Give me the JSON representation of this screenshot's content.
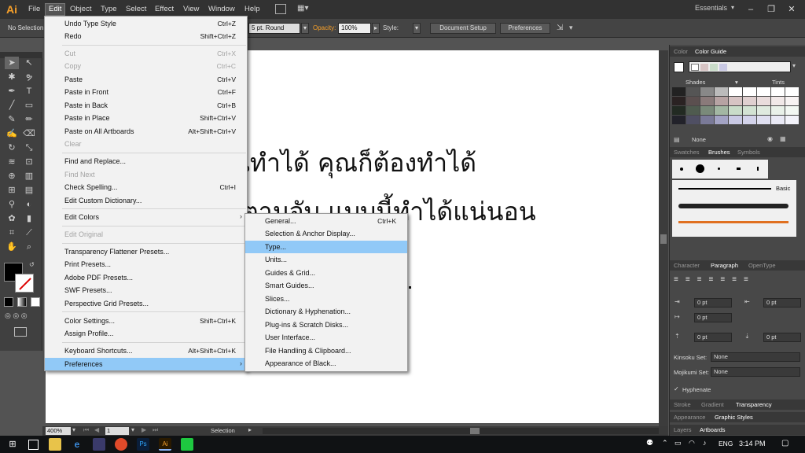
{
  "app": {
    "logo": "Ai",
    "menus": [
      "File",
      "Edit",
      "Object",
      "Type",
      "Select",
      "Effect",
      "View",
      "Window",
      "Help"
    ],
    "workspace": "Essentials",
    "window_controls": [
      "–",
      "❐",
      "✕"
    ]
  },
  "control_bar": {
    "selection_status": "No Selection",
    "brush": "5 pt. Round",
    "opacity_label": "Opacity:",
    "opacity_value": "100%",
    "style_label": "Style:",
    "document_setup": "Document Setup",
    "preferences": "Preferences"
  },
  "canvas": {
    "line1": "นทำได้ คุณก็ต้องทำได้",
    "line2": "ตามจับ แบบนี้ทำได้แน่นอน"
  },
  "status": {
    "zoom": "400%",
    "page": "1",
    "tool": "Selection"
  },
  "edit_menu": {
    "items": [
      {
        "label": "Undo Type Style",
        "shortcut": "Ctrl+Z"
      },
      {
        "label": "Redo",
        "shortcut": "Shift+Ctrl+Z"
      },
      {
        "label": "Cut",
        "shortcut": "Ctrl+X"
      },
      {
        "label": "Copy",
        "shortcut": "Ctrl+C"
      },
      {
        "label": "Paste",
        "shortcut": "Ctrl+V"
      },
      {
        "label": "Paste in Front",
        "shortcut": "Ctrl+F"
      },
      {
        "label": "Paste in Back",
        "shortcut": "Ctrl+B"
      },
      {
        "label": "Paste in Place",
        "shortcut": "Shift+Ctrl+V"
      },
      {
        "label": "Paste on All Artboards",
        "shortcut": "Alt+Shift+Ctrl+V"
      },
      {
        "label": "Clear",
        "shortcut": ""
      },
      {
        "label": "Find and Replace...",
        "shortcut": ""
      },
      {
        "label": "Find Next",
        "shortcut": ""
      },
      {
        "label": "Check Spelling...",
        "shortcut": "Ctrl+I"
      },
      {
        "label": "Edit Custom Dictionary...",
        "shortcut": ""
      },
      {
        "label": "Edit Colors",
        "shortcut": ""
      },
      {
        "label": "Edit Original",
        "shortcut": ""
      },
      {
        "label": "Transparency Flattener Presets...",
        "shortcut": ""
      },
      {
        "label": "Print Presets...",
        "shortcut": ""
      },
      {
        "label": "Adobe PDF Presets...",
        "shortcut": ""
      },
      {
        "label": "SWF Presets...",
        "shortcut": ""
      },
      {
        "label": "Perspective Grid Presets...",
        "shortcut": ""
      },
      {
        "label": "Color Settings...",
        "shortcut": "Shift+Ctrl+K"
      },
      {
        "label": "Assign Profile...",
        "shortcut": ""
      },
      {
        "label": "Keyboard Shortcuts...",
        "shortcut": "Alt+Shift+Ctrl+K"
      },
      {
        "label": "Preferences",
        "shortcut": ""
      }
    ]
  },
  "prefs_menu": {
    "items": [
      {
        "label": "General...",
        "shortcut": "Ctrl+K"
      },
      {
        "label": "Selection & Anchor Display...",
        "shortcut": ""
      },
      {
        "label": "Type...",
        "shortcut": ""
      },
      {
        "label": "Units...",
        "shortcut": ""
      },
      {
        "label": "Guides & Grid...",
        "shortcut": ""
      },
      {
        "label": "Smart Guides...",
        "shortcut": ""
      },
      {
        "label": "Slices...",
        "shortcut": ""
      },
      {
        "label": "Dictionary & Hyphenation...",
        "shortcut": ""
      },
      {
        "label": "Plug-ins & Scratch Disks...",
        "shortcut": ""
      },
      {
        "label": "User Interface...",
        "shortcut": ""
      },
      {
        "label": "File Handling & Clipboard...",
        "shortcut": ""
      },
      {
        "label": "Appearance of Black...",
        "shortcut": ""
      }
    ]
  },
  "panels": {
    "color_tabs": [
      "Color",
      "Color Guide"
    ],
    "shades": "Shades",
    "tints": "Tints",
    "none": "None",
    "brush_tabs": [
      "Swatches",
      "Brushes",
      "Symbols"
    ],
    "basic": "Basic",
    "para_tabs": [
      "Character",
      "Paragraph",
      "OpenType"
    ],
    "indent_values": [
      "0 pt",
      "0 pt",
      "0 pt",
      "0 pt",
      "0 pt"
    ],
    "kinsoku_label": "Kinsoku Set:",
    "kinsoku_value": "None",
    "mojikumi_label": "Mojikumi Set:",
    "mojikumi_value": "None",
    "hyphenate": "Hyphenate",
    "stroke_tabs": [
      "Stroke",
      "Gradient",
      "Transparency"
    ],
    "appearance_tabs": [
      "Appearance",
      "Graphic Styles"
    ],
    "layers_tabs": [
      "Layers",
      "Artboards"
    ]
  },
  "taskbar": {
    "lang": "ENG",
    "time": "3:14 PM"
  },
  "colors": {
    "highlight": "#91c9f7",
    "ai_orange": "#f7a02a"
  }
}
